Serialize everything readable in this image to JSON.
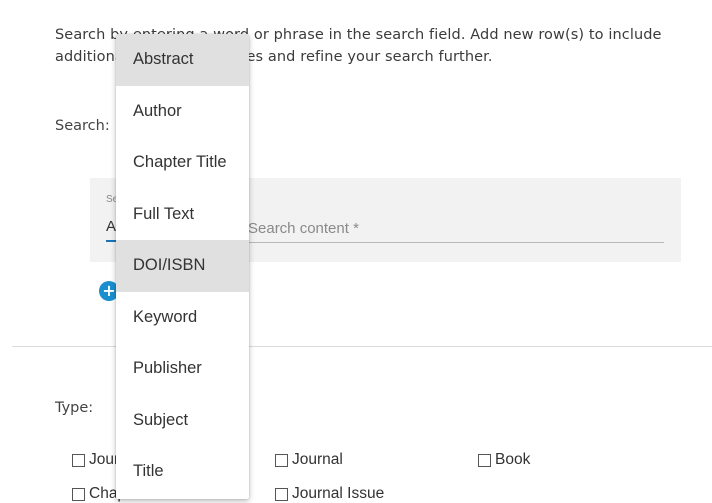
{
  "intro_text": "Search by entering a word or phrase in the search field. Add new row(s) to include additional search categories and refine your search further.",
  "search_label": "Search:",
  "search_row": {
    "field_label": "Search in",
    "field_value": "All",
    "content_placeholder": "Search content *"
  },
  "add_row_icon": "plus-circle-icon",
  "type_label": "Type:",
  "types": [
    {
      "label": "Journal Article"
    },
    {
      "label": "Journal"
    },
    {
      "label": "Book"
    },
    {
      "label": "Chapter"
    },
    {
      "label": "Journal Issue"
    }
  ],
  "menu": {
    "items": [
      {
        "label": "Abstract",
        "highlighted": true
      },
      {
        "label": "Author",
        "highlighted": false
      },
      {
        "label": "Chapter Title",
        "highlighted": false
      },
      {
        "label": "Full Text",
        "highlighted": false
      },
      {
        "label": "DOI/ISBN",
        "highlighted": true
      },
      {
        "label": "Keyword",
        "highlighted": false
      },
      {
        "label": "Publisher",
        "highlighted": false
      },
      {
        "label": "Subject",
        "highlighted": false
      },
      {
        "label": "Title",
        "highlighted": false
      }
    ]
  },
  "colors": {
    "accent": "#1a73b8",
    "add_button": "#1a8fd0",
    "row_background": "#f2f2f2",
    "menu_highlight": "#e0e0e0"
  }
}
